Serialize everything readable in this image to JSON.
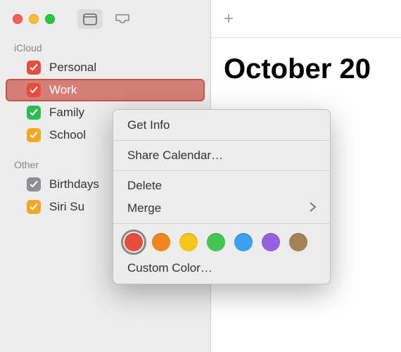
{
  "header": {
    "title": "October 20"
  },
  "sidebar": {
    "sections": [
      {
        "label": "iCloud",
        "items": [
          {
            "label": "Personal",
            "color": "#e74d3c",
            "checked": true,
            "selected": false
          },
          {
            "label": "Work",
            "color": "#e74d3c",
            "checked": true,
            "selected": true
          },
          {
            "label": "Family",
            "color": "#2dbb55",
            "checked": true,
            "selected": false
          },
          {
            "label": "School",
            "color": "#f5a623",
            "checked": true,
            "selected": false
          }
        ]
      },
      {
        "label": "Other",
        "items": [
          {
            "label": "Birthdays",
            "color": "#8e8e93",
            "checked": true,
            "selected": false
          },
          {
            "label": "Siri Su",
            "color": "#f5a623",
            "checked": true,
            "selected": false
          }
        ]
      }
    ]
  },
  "context_menu": {
    "get_info": "Get Info",
    "share": "Share Calendar…",
    "delete": "Delete",
    "merge": "Merge",
    "custom_color": "Custom Color…",
    "colors": [
      {
        "hex": "#e74d3c",
        "name": "red",
        "selected": true
      },
      {
        "hex": "#f0861d",
        "name": "orange",
        "selected": false
      },
      {
        "hex": "#f5c518",
        "name": "yellow",
        "selected": false
      },
      {
        "hex": "#44c553",
        "name": "green",
        "selected": false
      },
      {
        "hex": "#3aa0f2",
        "name": "blue",
        "selected": false
      },
      {
        "hex": "#9760e0",
        "name": "purple",
        "selected": false
      },
      {
        "hex": "#a38355",
        "name": "brown",
        "selected": false
      }
    ]
  }
}
